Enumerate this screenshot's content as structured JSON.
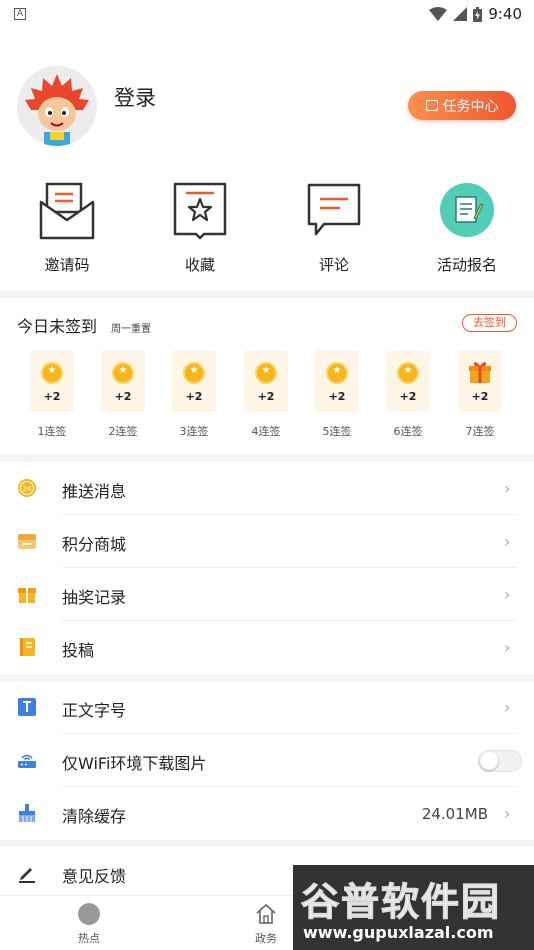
{
  "status_bar": {
    "time": "9:40",
    "left_badge": "A"
  },
  "profile": {
    "login_label": "登录",
    "task_center_label": "任务中心"
  },
  "quick_actions": [
    {
      "label": "邀请码",
      "icon": "envelope-icon"
    },
    {
      "label": "收藏",
      "icon": "bookmark-star-icon"
    },
    {
      "label": "评论",
      "icon": "comment-icon"
    },
    {
      "label": "活动报名",
      "icon": "signup-form-icon"
    }
  ],
  "checkin": {
    "title": "今日未签到",
    "subtitle": "周一重置",
    "button_label": "去签到",
    "days": [
      {
        "value": "+2",
        "label": "1连签",
        "reward": "coin"
      },
      {
        "value": "+2",
        "label": "2连签",
        "reward": "coin"
      },
      {
        "value": "+2",
        "label": "3连签",
        "reward": "coin"
      },
      {
        "value": "+2",
        "label": "4连签",
        "reward": "coin"
      },
      {
        "value": "+2",
        "label": "5连签",
        "reward": "coin"
      },
      {
        "value": "+2",
        "label": "6连签",
        "reward": "coin"
      },
      {
        "value": "+2",
        "label": "7连签",
        "reward": "gift"
      }
    ]
  },
  "menu_group_1": [
    {
      "label": "推送消息",
      "icon": "push-badge-icon"
    },
    {
      "label": "积分商城",
      "icon": "store-icon"
    },
    {
      "label": "抽奖记录",
      "icon": "gift-icon"
    },
    {
      "label": "投稿",
      "icon": "notebook-icon"
    }
  ],
  "menu_group_2": [
    {
      "label": "正文字号",
      "icon": "font-size-icon"
    },
    {
      "label": "仅WiFi环境下载图片",
      "icon": "wifi-router-icon",
      "toggle_on": false
    },
    {
      "label": "清除缓存",
      "icon": "broom-icon",
      "value": "24.01MB"
    }
  ],
  "menu_group_3": [
    {
      "label": "意见反馈",
      "icon": "pen-icon"
    }
  ],
  "tabbar": [
    {
      "label": "热点",
      "icon": "hot-dot-icon"
    },
    {
      "label": "政务",
      "icon": "home-icon"
    }
  ],
  "watermark": {
    "title": "谷普软件园",
    "url": "www.gupuxlazal.com"
  },
  "colors": {
    "accent": "#f05a2e",
    "coin": "#f6b51b",
    "divider": "#f4f4f4"
  }
}
